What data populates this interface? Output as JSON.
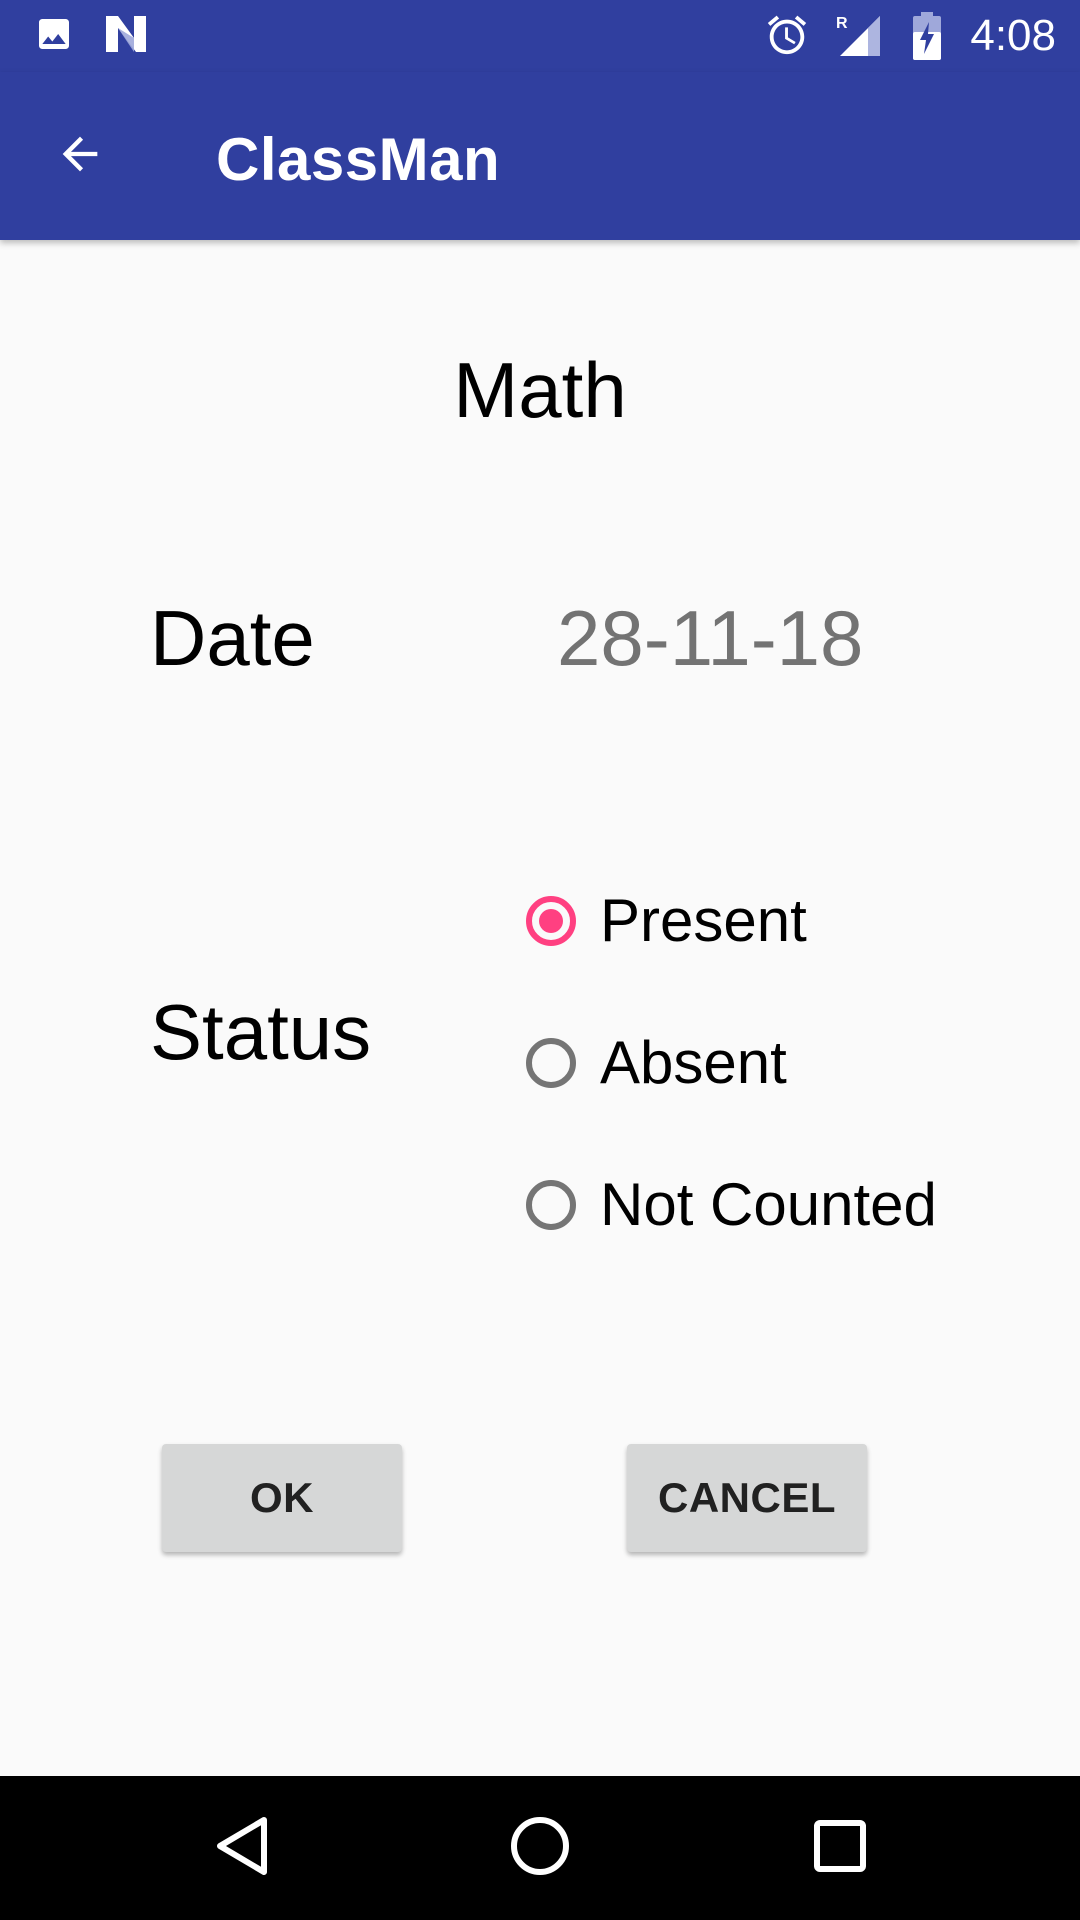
{
  "status_bar": {
    "time": "4:08",
    "icons": [
      "image-icon",
      "n-notification-icon",
      "alarm-icon",
      "signal-roaming-icon",
      "battery-charging-icon"
    ],
    "roaming_letter": "R",
    "color": "#303f9f"
  },
  "app_bar": {
    "title": "ClassMan",
    "back_icon": "arrow-back-icon",
    "color": "#303f9f"
  },
  "form": {
    "subject": "Math",
    "date_label": "Date",
    "date_value": "28-11-18",
    "status_label": "Status",
    "status_options": [
      {
        "label": "Present",
        "checked": true
      },
      {
        "label": "Absent",
        "checked": false
      },
      {
        "label": "Not Counted",
        "checked": false
      }
    ],
    "accent_color": "#ff4081"
  },
  "buttons": {
    "ok_label": "OK",
    "cancel_label": "CANCEL"
  },
  "nav_bar": {
    "icons": [
      "back-triangle-icon",
      "home-circle-icon",
      "recents-square-icon"
    ]
  }
}
